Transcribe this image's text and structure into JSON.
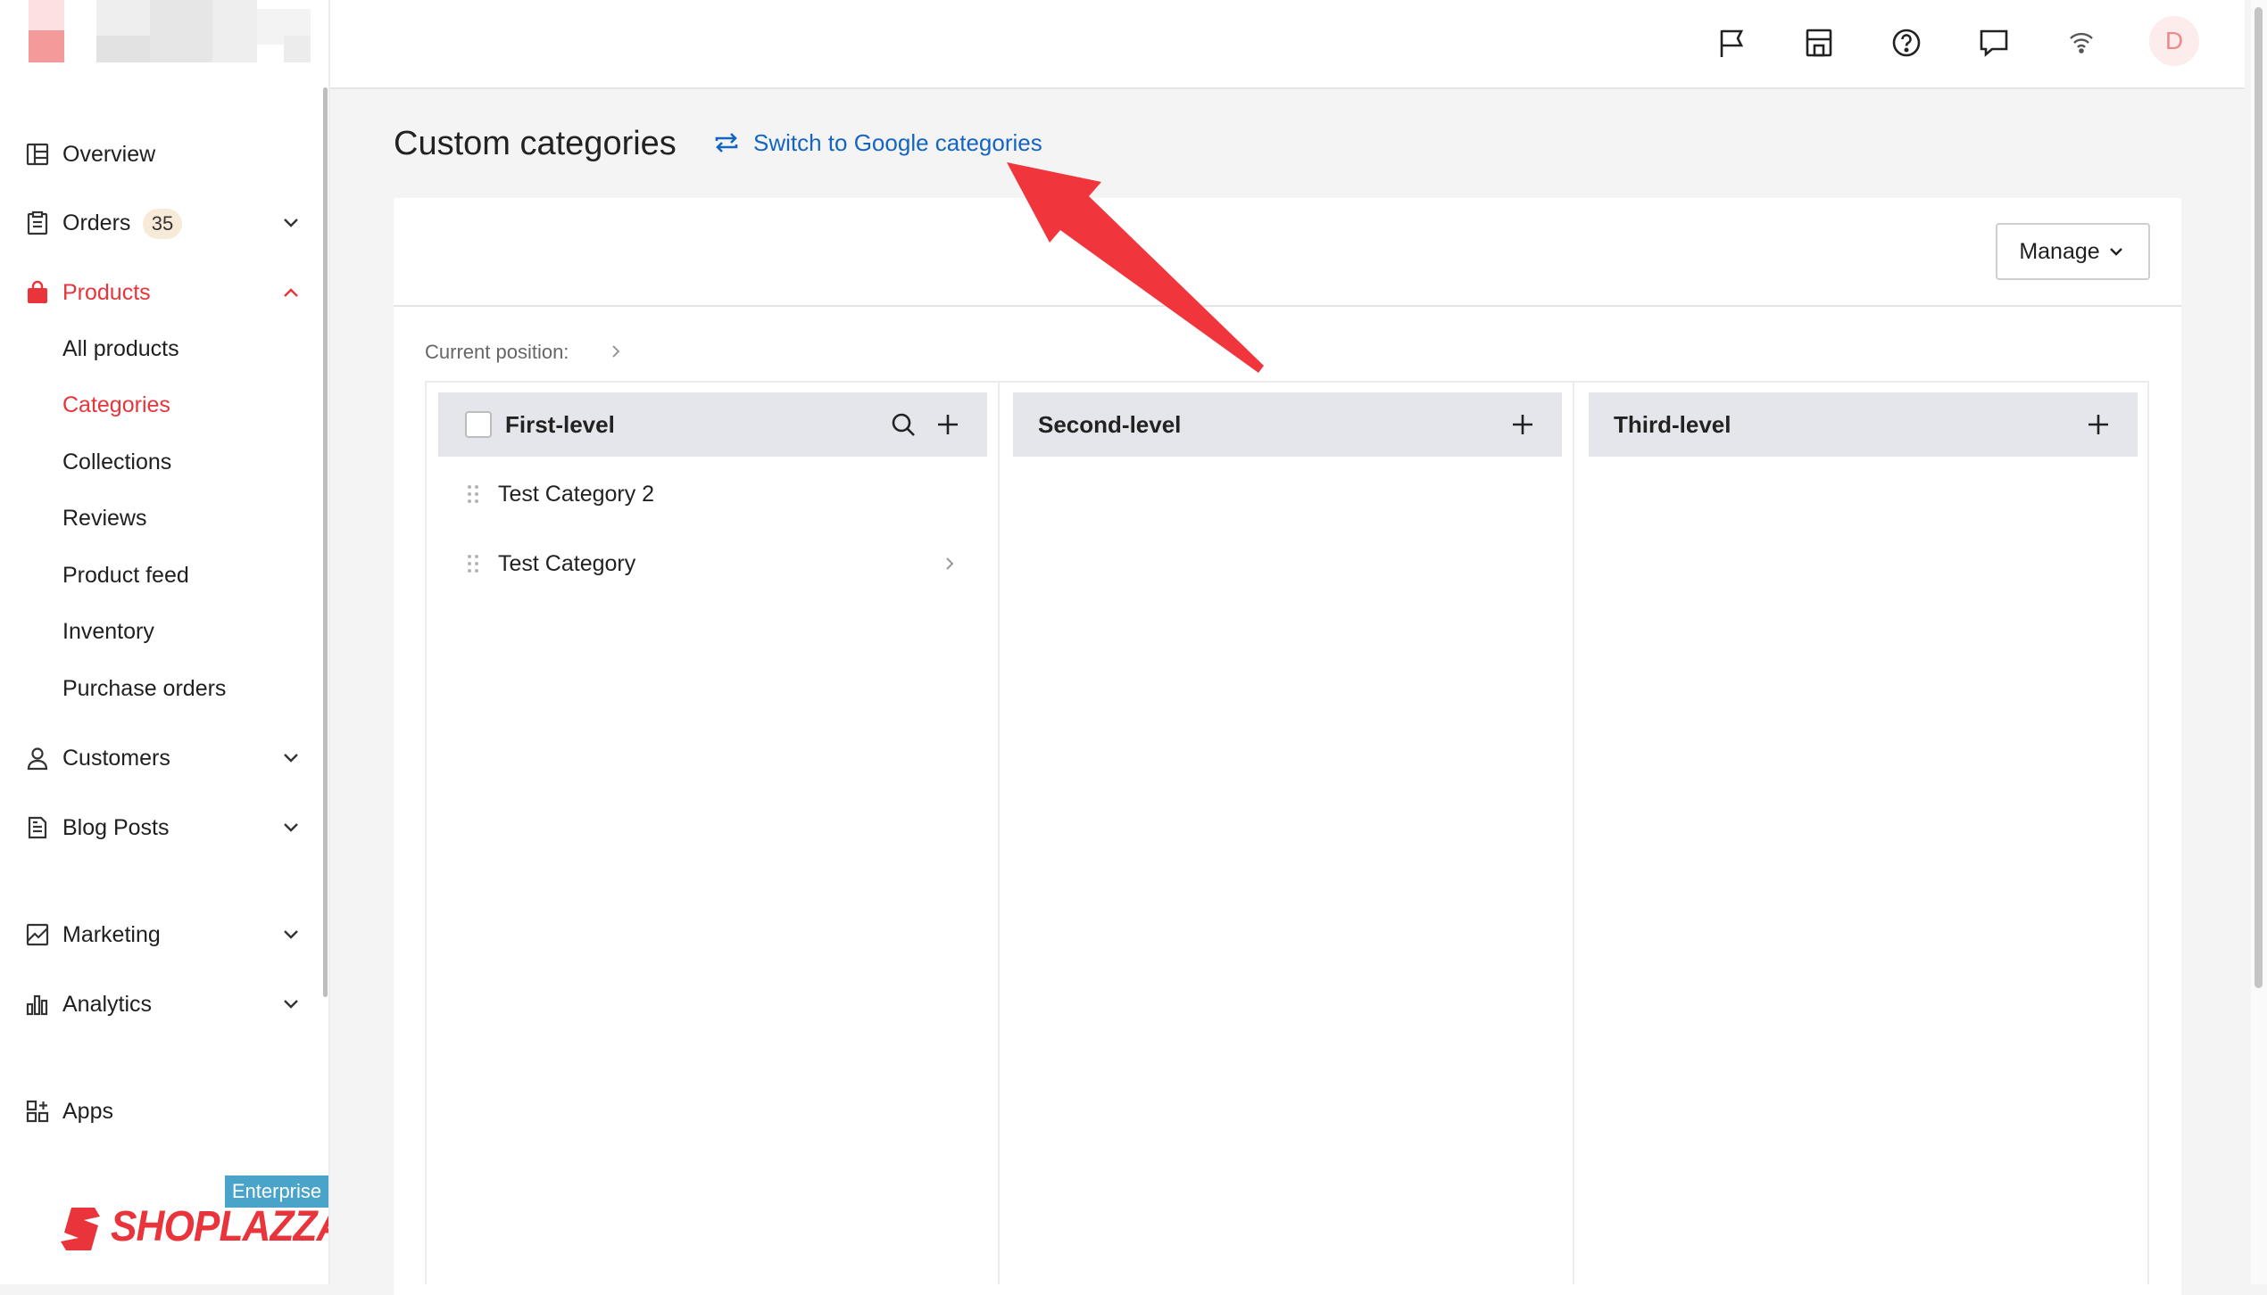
{
  "sidebar": {
    "nav": [
      {
        "label": "Overview",
        "icon": "overview-icon"
      },
      {
        "label": "Orders",
        "icon": "orders-icon",
        "badge": "35"
      },
      {
        "label": "Products",
        "icon": "products-bag-icon"
      },
      {
        "label": "Customers",
        "icon": "customers-icon"
      },
      {
        "label": "Blog Posts",
        "icon": "blog-posts-icon"
      },
      {
        "label": "Marketing",
        "icon": "marketing-icon"
      },
      {
        "label": "Analytics",
        "icon": "analytics-icon"
      },
      {
        "label": "Apps",
        "icon": "apps-icon"
      }
    ],
    "product_sub": [
      "All products",
      "Categories",
      "Collections",
      "Reviews",
      "Product feed",
      "Inventory",
      "Purchase orders"
    ],
    "active_sub": "Categories",
    "enterprise_badge": "Enterprise",
    "brand": "SHOPLAZZA"
  },
  "header": {
    "icons": [
      "flag-icon",
      "store-icon",
      "help-icon",
      "chat-icon",
      "wifi-icon"
    ],
    "avatar_initial": "D"
  },
  "main": {
    "title": "Custom categories",
    "switch_label": "Switch to Google categories",
    "manage_label": "Manage",
    "current_position_label": "Current position:",
    "columns": [
      {
        "title": "First-level"
      },
      {
        "title": "Second-level"
      },
      {
        "title": "Third-level"
      }
    ],
    "categories": [
      {
        "name": "Test Category 2",
        "has_children": false
      },
      {
        "name": "Test Category",
        "has_children": true
      }
    ]
  },
  "colors": {
    "accent_red": "#e8343a",
    "link_blue": "#1565c0",
    "column_header_bg": "#e4e6ec",
    "annotation_arrow": "#f0353d"
  }
}
